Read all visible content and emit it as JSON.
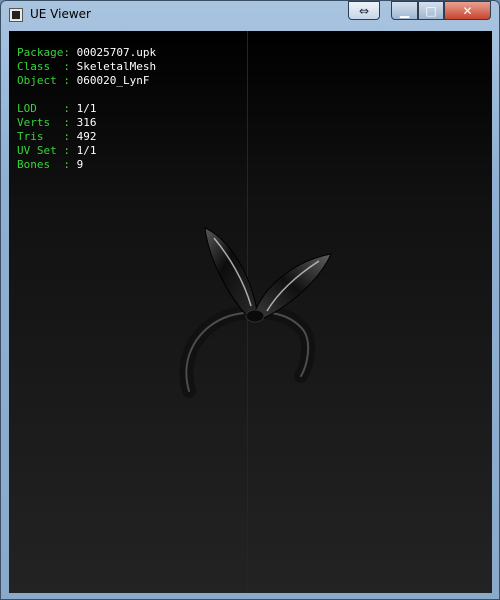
{
  "window": {
    "title": "UE Viewer"
  },
  "controls": {
    "swap_icon": "swap-arrows-icon",
    "minimize_icon": "minimize-icon",
    "maximize_icon": "maximize-icon",
    "close_icon": "close-icon",
    "swap_glyph": "⇔",
    "minimize_glyph": "▁",
    "maximize_glyph": "□",
    "close_glyph": "✕"
  },
  "info": {
    "package": {
      "key": "Package:",
      "value": "00025707.upk"
    },
    "class": {
      "key": "Class  :",
      "value": "SkeletalMesh"
    },
    "object": {
      "key": "Object :",
      "value": "060020_LynF"
    },
    "lod": {
      "key": "LOD    :",
      "value": "1/1"
    },
    "verts": {
      "key": "Verts  :",
      "value": "316"
    },
    "tris": {
      "key": "Tris   :",
      "value": "492"
    },
    "uvset": {
      "key": "UV Set :",
      "value": "1/1"
    },
    "bones": {
      "key": "Bones  :",
      "value": "9"
    }
  },
  "colors": {
    "key_text": "#35d43a",
    "value_text": "#ffffff",
    "axis_line": "#1414a8"
  }
}
